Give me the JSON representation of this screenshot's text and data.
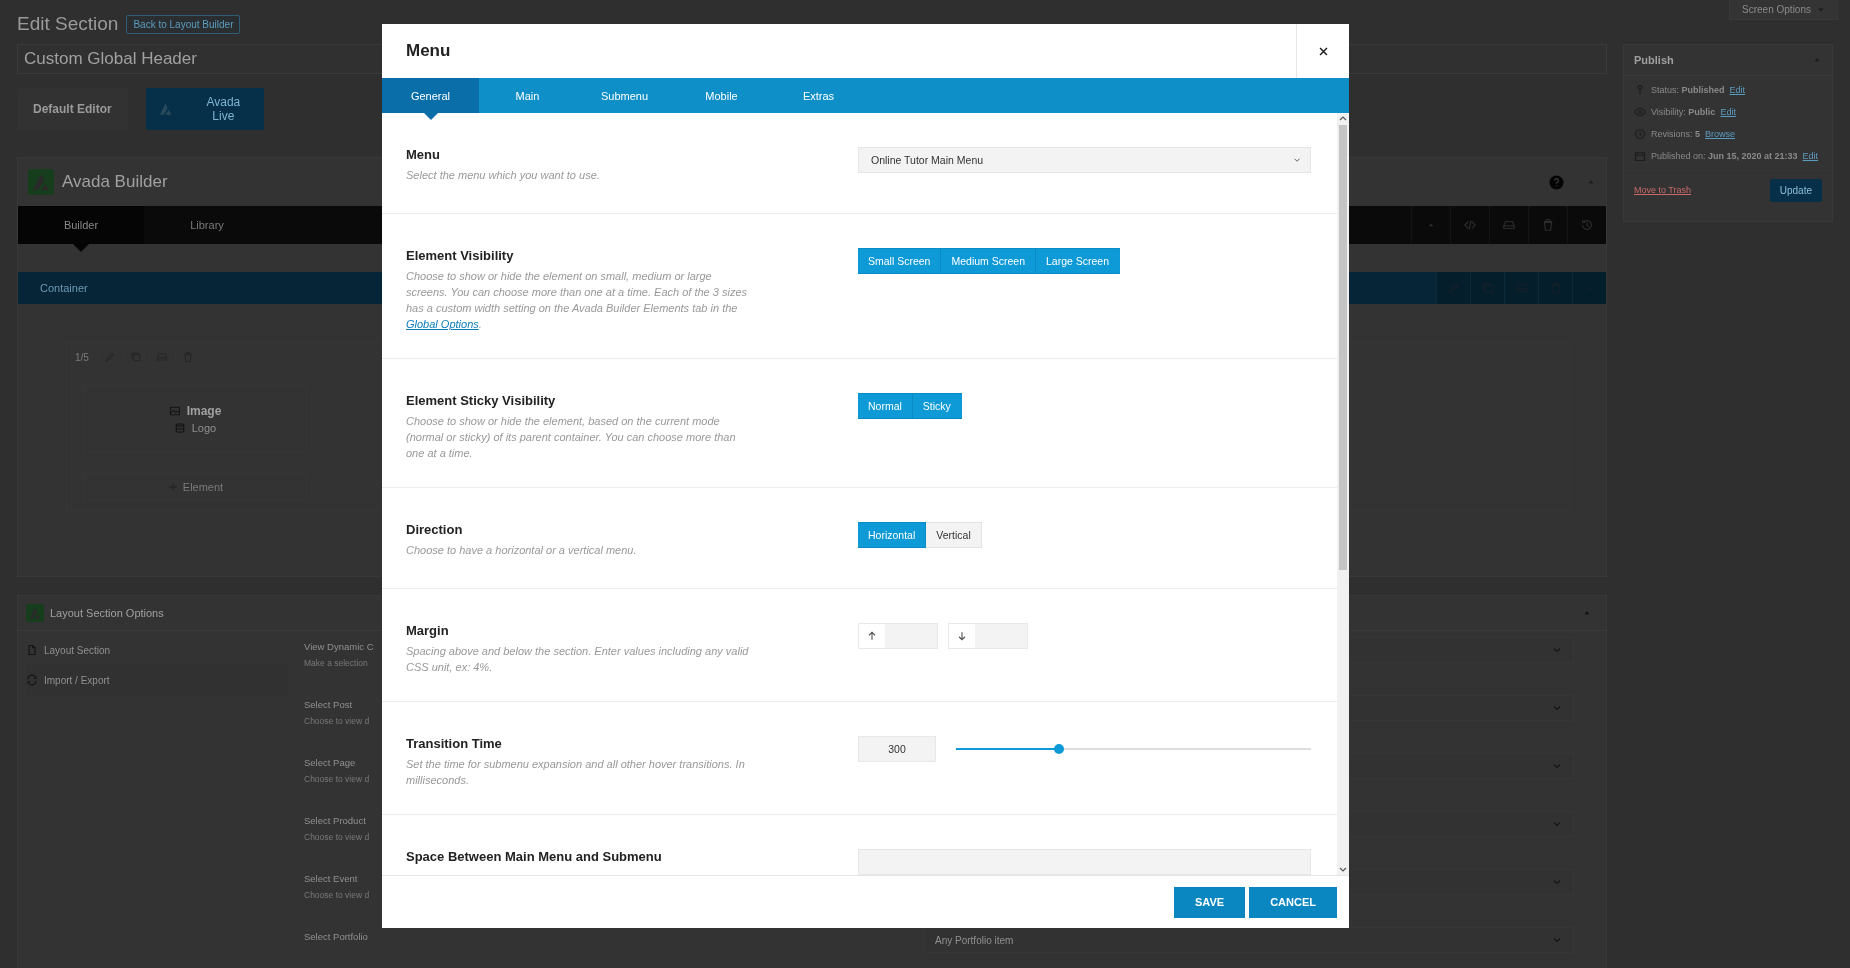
{
  "screen_options": {
    "label": "Screen Options"
  },
  "heading": {
    "title": "Edit Section",
    "back_button": "Back to Layout Builder"
  },
  "title_field": {
    "value": "Custom Global Header"
  },
  "editor_buttons": [
    {
      "label": "Default Editor",
      "kind": "plain"
    },
    {
      "label": "Avada Live",
      "kind": "brand"
    }
  ],
  "builder": {
    "title": "Avada Builder",
    "tabs": [
      {
        "label": "Builder",
        "selected": true
      },
      {
        "label": "Library",
        "selected": false
      }
    ],
    "container": {
      "label": "Container"
    },
    "column": {
      "fraction": "1/5",
      "element": {
        "title": "Image",
        "subtitle": "Logo"
      },
      "add_label": "Element"
    }
  },
  "options_panel": {
    "title": "Layout Section Options",
    "nav": [
      {
        "label": "Layout Section"
      },
      {
        "label": "Import / Export"
      }
    ],
    "fields": [
      {
        "label": "View Dynamic C",
        "hint": "Make a selection"
      },
      {
        "label": "Select Post",
        "hint": "Choose to view d"
      },
      {
        "label": "Select Page",
        "hint": "Choose to view d"
      },
      {
        "label": "Select Product",
        "hint": "Choose to view d"
      },
      {
        "label": "Select Event",
        "hint": "Choose to view d"
      },
      {
        "label": "Select Portfolio",
        "value": "Any Portfolio item"
      }
    ]
  },
  "publish": {
    "title": "Publish",
    "rows": [
      {
        "text": "Status: **Published**",
        "link": "Edit"
      },
      {
        "text": "Visibility: **Public**",
        "link": "Edit"
      },
      {
        "text": "Revisions: **5**",
        "link": "Browse"
      },
      {
        "text": "Published on: **Jun 15, 2020 at 21:33**",
        "link": "Edit"
      }
    ],
    "trash_link": "Move to Trash",
    "update_button": "Update"
  },
  "modal": {
    "title": "Menu",
    "tabs": [
      {
        "label": "General",
        "selected": true
      },
      {
        "label": "Main",
        "selected": false
      },
      {
        "label": "Submenu",
        "selected": false
      },
      {
        "label": "Mobile",
        "selected": false
      },
      {
        "label": "Extras",
        "selected": false
      }
    ],
    "sections": [
      {
        "kind": "select",
        "title": "Menu",
        "description": "Select the menu which you want to use.",
        "value": "Online Tutor Main Menu"
      },
      {
        "kind": "buttonset",
        "title": "Element Visibility",
        "description": "Choose to show or hide the element on small, medium or large screens. You can choose more than one at a time. Each of the 3 sizes has a custom width setting on the Avada Builder Elements tab in the",
        "link": "Global Options",
        "link_suffix": ".",
        "options": [
          {
            "label": "Small Screen",
            "selected": true
          },
          {
            "label": "Medium Screen",
            "selected": true
          },
          {
            "label": "Large Screen",
            "selected": true
          }
        ]
      },
      {
        "kind": "buttonset",
        "title": "Element Sticky Visibility",
        "description": "Choose to show or hide the element, based on the current mode (normal or sticky) of its parent container. You can choose more than one at a time.",
        "options": [
          {
            "label": "Normal",
            "selected": true
          },
          {
            "label": "Sticky",
            "selected": true
          }
        ]
      },
      {
        "kind": "buttonset",
        "title": "Direction",
        "description": "Choose to have a horizontal or a vertical menu.",
        "options": [
          {
            "label": "Horizontal",
            "selected": true
          },
          {
            "label": "Vertical",
            "selected": false
          }
        ]
      },
      {
        "kind": "dimensions",
        "title": "Margin",
        "description": "Spacing above and below the section. Enter values including any valid CSS unit, ex: 4%."
      },
      {
        "kind": "range",
        "title": "Transition Time",
        "description": "Set the time for submenu expansion and all other hover transitions. In milliseconds.",
        "value": "300",
        "level": 0.29
      },
      {
        "kind": "select",
        "title": "Space Between Main Menu and Submenu"
      }
    ],
    "buttons": [
      {
        "label": "SAVE"
      },
      {
        "label": "CANCEL"
      }
    ]
  }
}
